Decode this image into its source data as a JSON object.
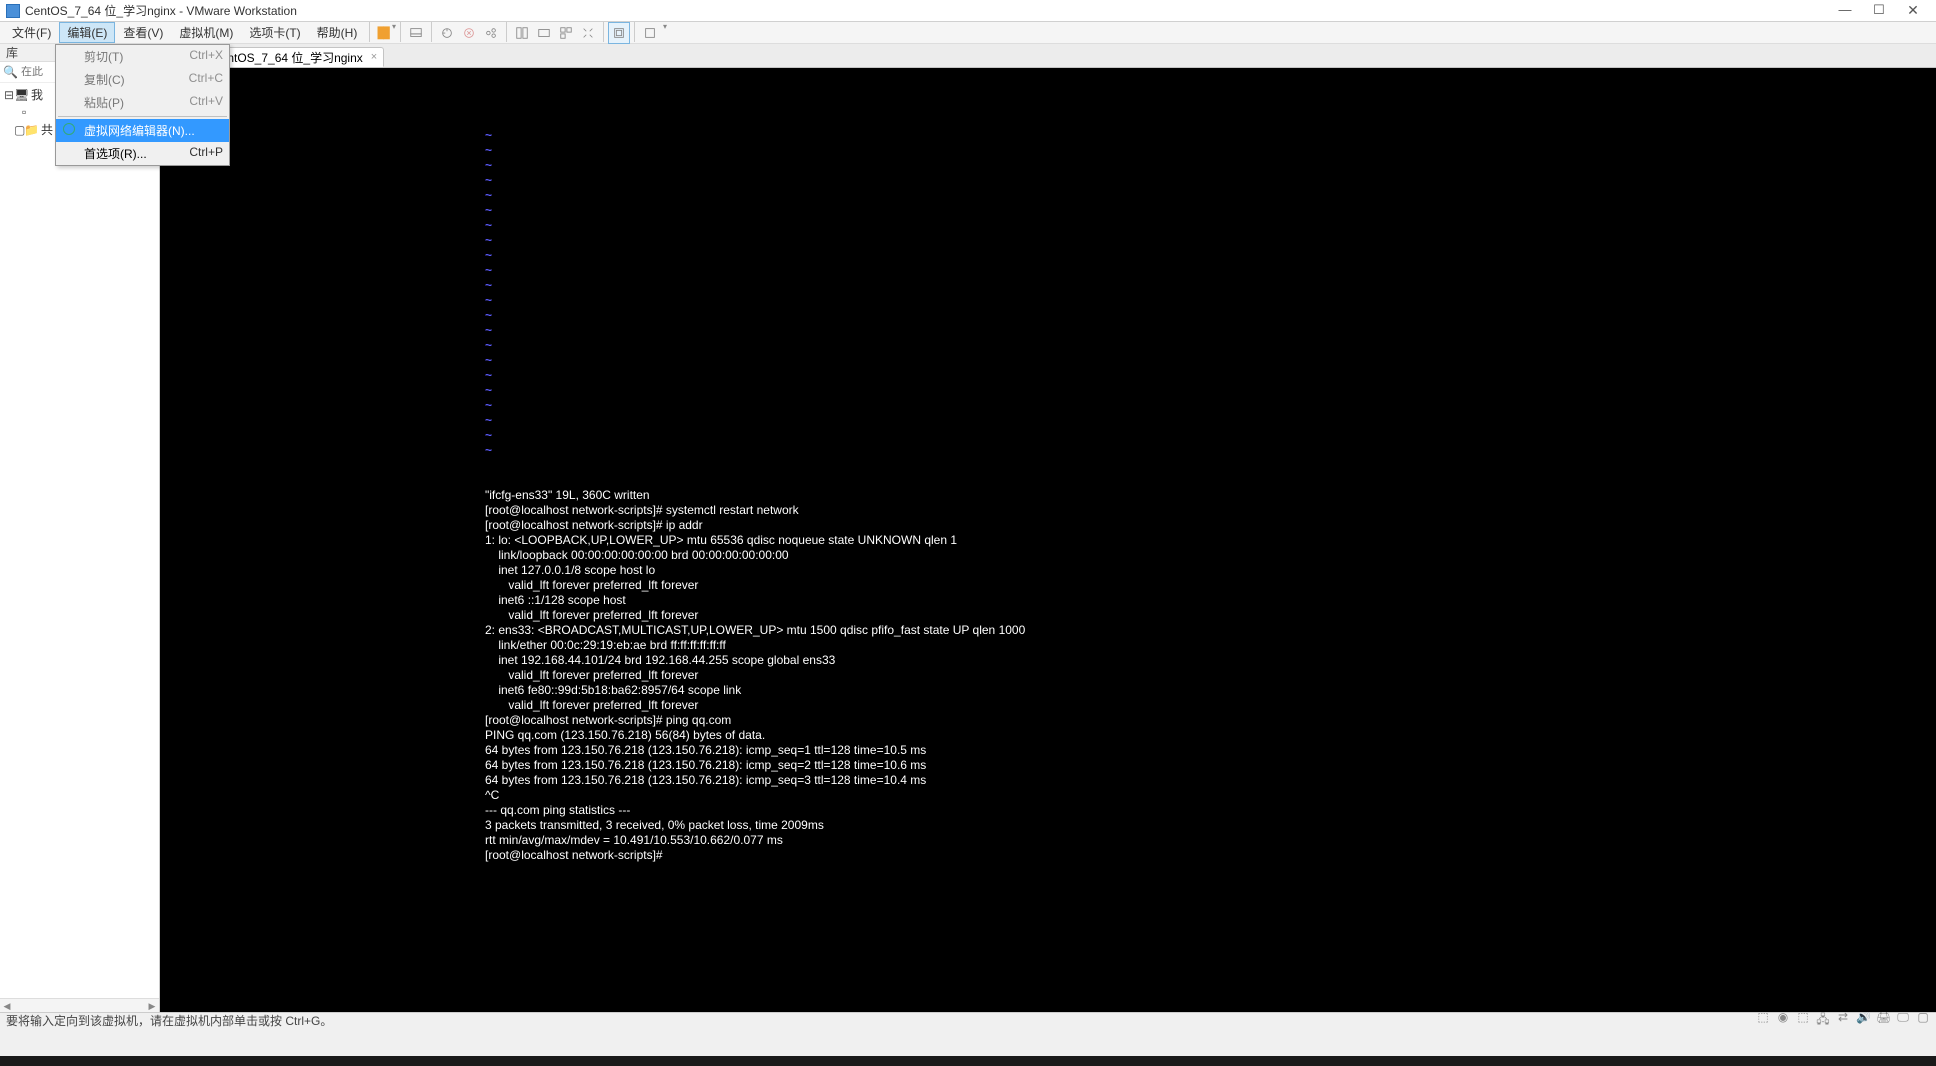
{
  "window": {
    "title": "CentOS_7_64 位_学习nginx - VMware Workstation"
  },
  "menubar": {
    "file": "文件(F)",
    "edit": "编辑(E)",
    "view": "查看(V)",
    "vm": "虚拟机(M)",
    "tabs": "选项卡(T)",
    "help": "帮助(H)"
  },
  "edit_menu": {
    "cut": "剪切(T)",
    "cut_sc": "Ctrl+X",
    "copy": "复制(C)",
    "copy_sc": "Ctrl+C",
    "paste": "粘贴(P)",
    "paste_sc": "Ctrl+V",
    "vne": "虚拟网络编辑器(N)...",
    "prefs": "首选项(R)...",
    "prefs_sc": "Ctrl+P"
  },
  "sidebar": {
    "header": "库",
    "header_close": "×",
    "search_placeholder": "在此",
    "tree": {
      "root_exp": "⊟",
      "root": "我",
      "child1": "",
      "child2_exp": "▢",
      "child2": "共"
    }
  },
  "tab": {
    "label": "CentOS_7_64 位_学习nginx",
    "close": "×"
  },
  "terminal": {
    "tildes": "~\n~\n~\n~\n~\n~\n~\n~\n~\n~\n~\n~\n~\n~\n~\n~\n~\n~\n~\n~\n~\n~",
    "text": "\"ifcfg-ens33\" 19L, 360C written\n[root@localhost network-scripts]# systemctl restart network\n[root@localhost network-scripts]# ip addr\n1: lo: <LOOPBACK,UP,LOWER_UP> mtu 65536 qdisc noqueue state UNKNOWN qlen 1\n    link/loopback 00:00:00:00:00:00 brd 00:00:00:00:00:00\n    inet 127.0.0.1/8 scope host lo\n       valid_lft forever preferred_lft forever\n    inet6 ::1/128 scope host\n       valid_lft forever preferred_lft forever\n2: ens33: <BROADCAST,MULTICAST,UP,LOWER_UP> mtu 1500 qdisc pfifo_fast state UP qlen 1000\n    link/ether 00:0c:29:19:eb:ae brd ff:ff:ff:ff:ff:ff\n    inet 192.168.44.101/24 brd 192.168.44.255 scope global ens33\n       valid_lft forever preferred_lft forever\n    inet6 fe80::99d:5b18:ba62:8957/64 scope link\n       valid_lft forever preferred_lft forever\n[root@localhost network-scripts]# ping qq.com\nPING qq.com (123.150.76.218) 56(84) bytes of data.\n64 bytes from 123.150.76.218 (123.150.76.218): icmp_seq=1 ttl=128 time=10.5 ms\n64 bytes from 123.150.76.218 (123.150.76.218): icmp_seq=2 ttl=128 time=10.6 ms\n64 bytes from 123.150.76.218 (123.150.76.218): icmp_seq=3 ttl=128 time=10.4 ms\n^C\n--- qq.com ping statistics ---\n3 packets transmitted, 3 received, 0% packet loss, time 2009ms\nrtt min/avg/max/mdev = 10.491/10.553/10.662/0.077 ms\n[root@localhost network-scripts]#"
  },
  "status": {
    "text": "要将输入定向到该虚拟机，请在虚拟机内部单击或按 Ctrl+G。"
  }
}
